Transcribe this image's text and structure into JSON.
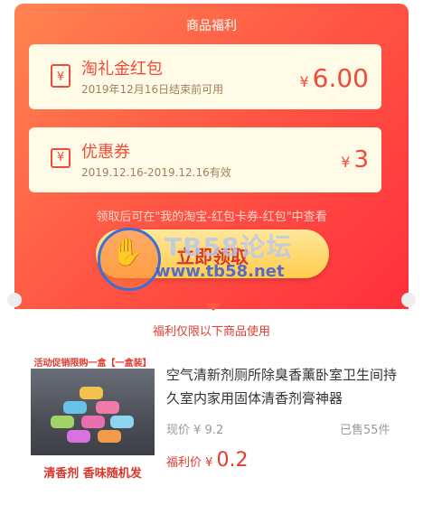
{
  "header": {
    "title": "商品福利"
  },
  "red_envelope": {
    "name": "淘礼金红包",
    "note": "2019年12月16日结束前可用",
    "currency": "¥",
    "amount": "6.00",
    "icon": "envelope-icon"
  },
  "coupon": {
    "name": "优惠券",
    "note": "2019.12.16-2019.12.16有效",
    "currency": "¥",
    "amount": "3",
    "icon": "ticket-icon"
  },
  "hint": "领取后可在\"我的淘宝-红包卡券-红包\"中查看",
  "claim_button": {
    "label": "立即领取"
  },
  "watermark": {
    "line1": "TB58论坛",
    "line2": "www.tb58.net"
  },
  "section": {
    "title": "福利仅限以下商品使用"
  },
  "product": {
    "image_top_text": "活动促销限购一盒【一盒装】",
    "image_bottom_text": "清香剂  香味随机发",
    "name": "空气清新剂厕所除臭香薰卧室卫生间持久室内家用固体清香剂膏神器",
    "price_label": "现价 ¥ 9.2",
    "sold_label": "已售55件",
    "welfare_label": "福利价 ¥",
    "welfare_value": "0.2"
  },
  "colors": {
    "accent": "#f24a3a",
    "card_bg": "#fffbe6",
    "button": "#ffd25a"
  }
}
